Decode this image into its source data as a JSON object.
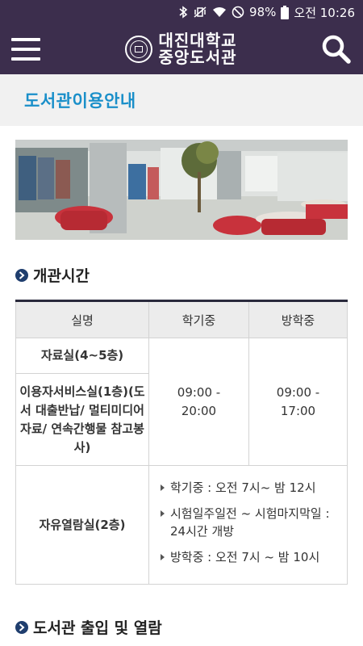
{
  "status_bar": {
    "battery": "98%",
    "time": "오전 10:26"
  },
  "header": {
    "logo_line1": "대진대학교",
    "logo_line2": "중앙도서관"
  },
  "page": {
    "title": "도서관이용안내"
  },
  "sections": {
    "opening_hours": "개관시간",
    "entry": "도서관 출입 및 열람"
  },
  "table": {
    "headers": [
      "실명",
      "학기중",
      "방학중"
    ],
    "rows": [
      {
        "room": "자료실(4~5층)"
      },
      {
        "room": "이용자서비스실(1층)(도서 대출반납/ 멀티미디어자료/ 연속간행물 참고봉사)"
      },
      {
        "room": "자유열람실(2층)"
      }
    ],
    "semester_hours": "09:00 - 20:00",
    "vacation_hours": "09:00 - 17:00",
    "reading_room_notes": [
      "학기중 : 오전 7시~ 밤 12시",
      "시험일주일전 ~ 시험마지막일 : 24시간 개방",
      "방학중 : 오전 7시 ~ 밤 10시"
    ]
  }
}
